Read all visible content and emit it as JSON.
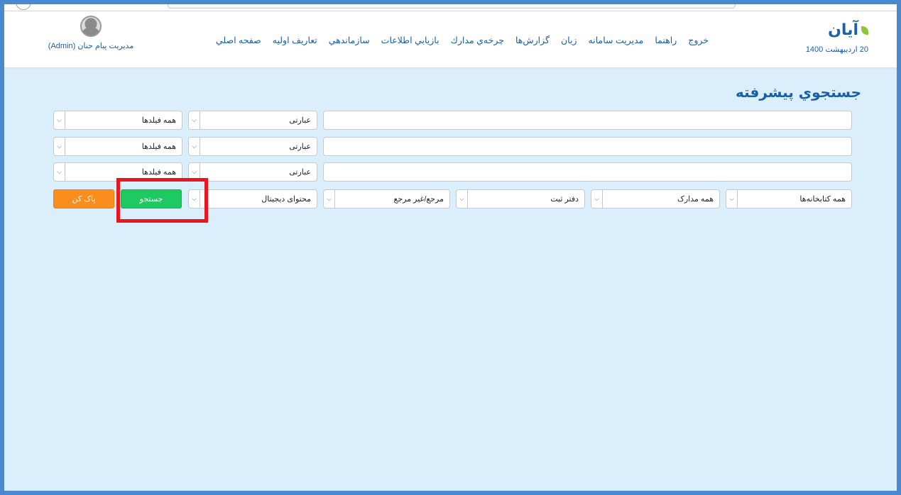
{
  "app": {
    "logo_text": "آیان",
    "date": "20 اردیبهشت 1400",
    "user_name": "مدیریت پیام حنان (Admin)",
    "accent_color": "#1a5fa8"
  },
  "nav": {
    "items": [
      {
        "label": "صفحه اصلي"
      },
      {
        "label": "تعاريف اوليه"
      },
      {
        "label": "سازماندهي"
      },
      {
        "label": "بازيابي اطلاعات"
      },
      {
        "label": "چرخه‌ي مدارك"
      },
      {
        "label": "گزارش‌ها"
      },
      {
        "label": "زبان"
      },
      {
        "label": "مديريت سامانه"
      },
      {
        "label": "راهنما"
      },
      {
        "label": "خروج"
      }
    ]
  },
  "search": {
    "title": "جستجوي پيشرفته",
    "rows": [
      {
        "query": "",
        "mode": "عبارتی",
        "field": "همه فیلدها"
      },
      {
        "query": "",
        "mode": "عبارتی",
        "field": "همه فیلدها"
      },
      {
        "query": "",
        "mode": "عبارتی",
        "field": "همه فیلدها"
      }
    ],
    "filters": {
      "library": "همه کتابخانه‌ها",
      "doc_type": "همه مدارک",
      "register": "دفتر ثبت",
      "reference": "مرجع/غیر مرجع",
      "digital": "محتوای دیجیتال"
    },
    "search_button": "جستجو",
    "clear_button": "پاک کن"
  }
}
